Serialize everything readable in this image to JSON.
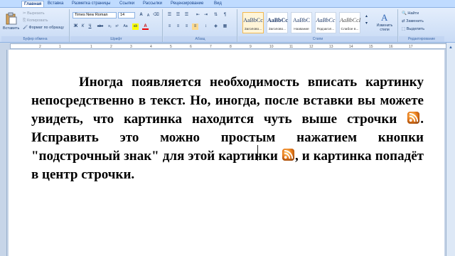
{
  "tabs": [
    "Главная",
    "Вставка",
    "Разметка страницы",
    "Ссылки",
    "Рассылки",
    "Рецензирование",
    "Вид"
  ],
  "clipboard": {
    "paste_label": "Вставить",
    "cut_label": "Вырезать",
    "copy_label": "Копировать",
    "format_painter_label": "Формат по образцу",
    "caption": "Буфер обмена"
  },
  "font": {
    "name": "Times New Roman",
    "size": "14",
    "caption": "Шрифт",
    "bold": "Ж",
    "italic": "К",
    "underline": "Ч",
    "strike": "abe",
    "subscript": "x₂",
    "superscript": "x²",
    "case": "Aa",
    "highlight": "ab",
    "color": "A",
    "grow": "A",
    "shrink": "A"
  },
  "paragraph": {
    "caption": "Абзац",
    "pilcrow": "¶"
  },
  "styles": {
    "caption": "Стили",
    "items": [
      {
        "sample": "AaBbCc",
        "name": "Заголово..."
      },
      {
        "sample": "AaBbCc",
        "name": "Заголово..."
      },
      {
        "sample": "AaBbC",
        "name": "Название"
      },
      {
        "sample": "AaBbCc",
        "name": "Подзагол..."
      },
      {
        "sample": "AaBbCcI",
        "name": "Слабое в..."
      }
    ],
    "change_styles_label": "Изменить стили"
  },
  "editing": {
    "caption": "Редактирование",
    "find_label": "Найти",
    "replace_label": "Заменить",
    "select_label": "Выделить"
  },
  "ruler_numbers": [
    "2",
    "1",
    "1",
    "2",
    "3",
    "4",
    "5",
    "6",
    "7",
    "8",
    "9",
    "10",
    "11",
    "12",
    "13",
    "14",
    "15",
    "16",
    "17"
  ],
  "document": {
    "part1": "Иногда появляется необходимость вписать картинку непосредственно в текст. Но, иногда, после вставки вы можете увидеть, что картинка находится чуть выше строчки ",
    "part2": ". Исправить это можно простым нажатием кнопки \"подстрочный знак\" для этой картинки ",
    "part3": ", и картинка попадёт в центр строчки."
  },
  "colors": {
    "ribbon_top": "#e4eefc",
    "ribbon_bottom": "#c9dbf5",
    "accent": "#15428b",
    "rss_orange": "#e87b1a"
  }
}
